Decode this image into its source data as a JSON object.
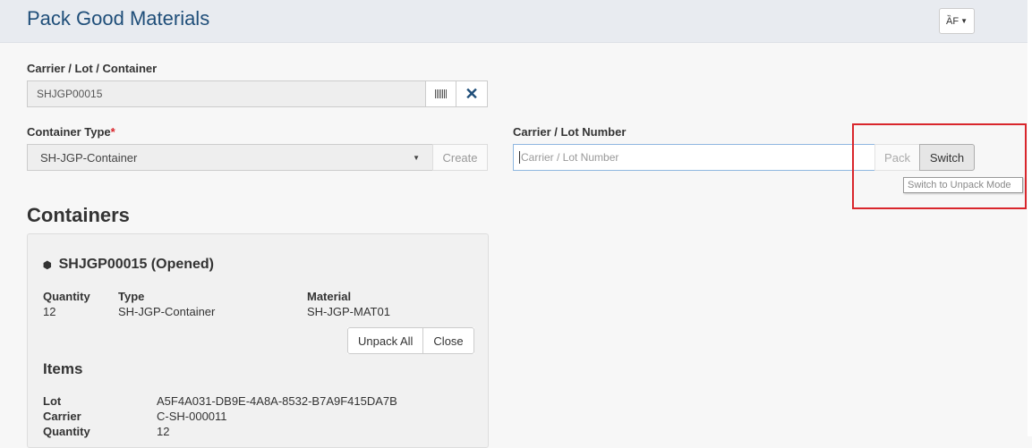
{
  "header": {
    "title": "Pack Good Materials",
    "menu_icon_glyph": "ȀF"
  },
  "carrier_field": {
    "label": "Carrier / Lot / Container",
    "value": "SHJGP00015"
  },
  "container_type": {
    "label": "Container Type",
    "required_marker": "*",
    "selected": "SH-JGP-Container",
    "create_label": "Create"
  },
  "lot_number": {
    "label": "Carrier / Lot Number",
    "placeholder": "Carrier / Lot Number",
    "pack_label": "Pack",
    "switch_label": "Switch",
    "tooltip": "Switch to Unpack Mode"
  },
  "containers": {
    "title": "Containers",
    "card": {
      "name": "SHJGP00015 (Opened)",
      "quantity_label": "Quantity",
      "quantity": "12",
      "type_label": "Type",
      "type": "SH-JGP-Container",
      "material_label": "Material",
      "material": "SH-JGP-MAT01",
      "unpack_all_label": "Unpack All",
      "close_label": "Close",
      "items_title": "Items",
      "lot_label": "Lot",
      "lot": "A5F4A031-DB9E-4A8A-8532-B7A9F415DA7B",
      "carrier_label": "Carrier",
      "carrier": "C-SH-000011",
      "item_quantity_label": "Quantity",
      "item_quantity": "12"
    }
  },
  "colors": {
    "title": "#1f4e79",
    "highlight": "#d9262c",
    "required": "#d9262c"
  }
}
